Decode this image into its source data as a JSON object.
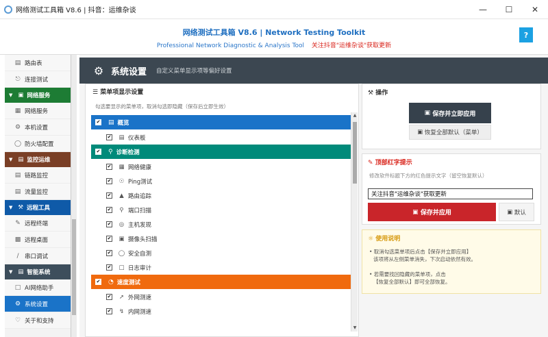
{
  "window": {
    "title": "网络测试工具箱 V8.6 | 抖音：运维杂谈",
    "min_icon": "minimize-icon",
    "max_icon": "maximize-icon",
    "close_icon": "close-icon"
  },
  "header": {
    "title": "网络测试工具箱 V8.6 | Network Testing Toolkit",
    "subtitle": "Professional Network Diagnostic & Analysis Tool",
    "promo": "关注抖音\"运维杂谈\"获取更新",
    "help_label": "?"
  },
  "sidebar": {
    "items_top": [
      {
        "label": "路由表",
        "icon": "route-icon"
      },
      {
        "label": "连接测试",
        "icon": "link-icon"
      }
    ],
    "groups": [
      {
        "label": "网络服务",
        "color": "#1d7c34",
        "items": [
          {
            "label": "网络服务",
            "icon": "network-icon"
          },
          {
            "label": "本机设置",
            "icon": "gear-icon"
          },
          {
            "label": "防火墙配置",
            "icon": "shield-icon"
          }
        ]
      },
      {
        "label": "监控运维",
        "color": "#7a3f26",
        "items": [
          {
            "label": "链路监控",
            "icon": "chart-icon"
          },
          {
            "label": "流量监控",
            "icon": "traffic-icon"
          }
        ]
      },
      {
        "label": "远程工具",
        "color": "#0f5aa8",
        "items": [
          {
            "label": "远程终端",
            "icon": "terminal-icon"
          },
          {
            "label": "远程桌面",
            "icon": "desktop-icon"
          },
          {
            "label": "串口调试",
            "icon": "serial-icon"
          }
        ]
      },
      {
        "label": "智能系统",
        "color": "#3d4e5c",
        "items": [
          {
            "label": "AI网络助手",
            "icon": "chat-icon"
          },
          {
            "label": "系统设置",
            "icon": "gear-icon",
            "active": true
          },
          {
            "label": "关于和支持",
            "icon": "heart-icon"
          }
        ]
      }
    ]
  },
  "main": {
    "title": "系统设置",
    "subtitle": "自定义菜单显示项等偏好设置",
    "menu_panel": {
      "title": "菜单项显示设置",
      "desc": "勾选要显示的菜单项，取消勾选即隐藏（保存后立即生效）",
      "categories": [
        {
          "label": "概览",
          "color": "#1a73c8",
          "checked": true,
          "items": [
            {
              "label": "仪表板",
              "icon": "dashboard-icon",
              "checked": true
            }
          ]
        },
        {
          "label": "诊断检测",
          "color": "#008a7a",
          "checked": true,
          "items": [
            {
              "label": "网络健康",
              "icon": "network-icon",
              "checked": true
            },
            {
              "label": "Ping测试",
              "icon": "ping-icon",
              "checked": true
            },
            {
              "label": "路由追踪",
              "icon": "route-icon",
              "checked": true
            },
            {
              "label": "端口扫描",
              "icon": "search-icon",
              "checked": true
            },
            {
              "label": "主机发现",
              "icon": "globe-icon",
              "checked": true
            },
            {
              "label": "摄像头扫描",
              "icon": "camera-icon",
              "checked": true
            },
            {
              "label": "安全自测",
              "icon": "shield-icon",
              "checked": true
            },
            {
              "label": "日志审计",
              "icon": "log-icon",
              "checked": true
            }
          ]
        },
        {
          "label": "速度测试",
          "color": "#f06a0e",
          "checked": true,
          "items": [
            {
              "label": "外网测速",
              "icon": "rocket-icon",
              "checked": true
            },
            {
              "label": "内网测速",
              "icon": "bolt-icon",
              "checked": true
            }
          ]
        }
      ]
    },
    "actions": {
      "title": "操作",
      "save_apply": "保存并立即应用",
      "restore": "恢复全部默认（菜单）"
    },
    "tip_bar": {
      "title": "顶部红字提示",
      "desc": "修改软件标题下方的红色提示文字（留空恢复默认）",
      "value": "关注抖音\"运维杂谈\"获取更新",
      "save": "保存并应用",
      "default": "默认"
    },
    "help": {
      "title": "使用说明",
      "tips": [
        "• 取消勾选菜单项后点击【保存并立即应用】",
        "该项将从左侧菜单消失，下次启动依然有效。",
        "• 若需要找回隐藏的菜单项，点击",
        "【恢复全部默认】即可全部恢复。"
      ]
    }
  }
}
